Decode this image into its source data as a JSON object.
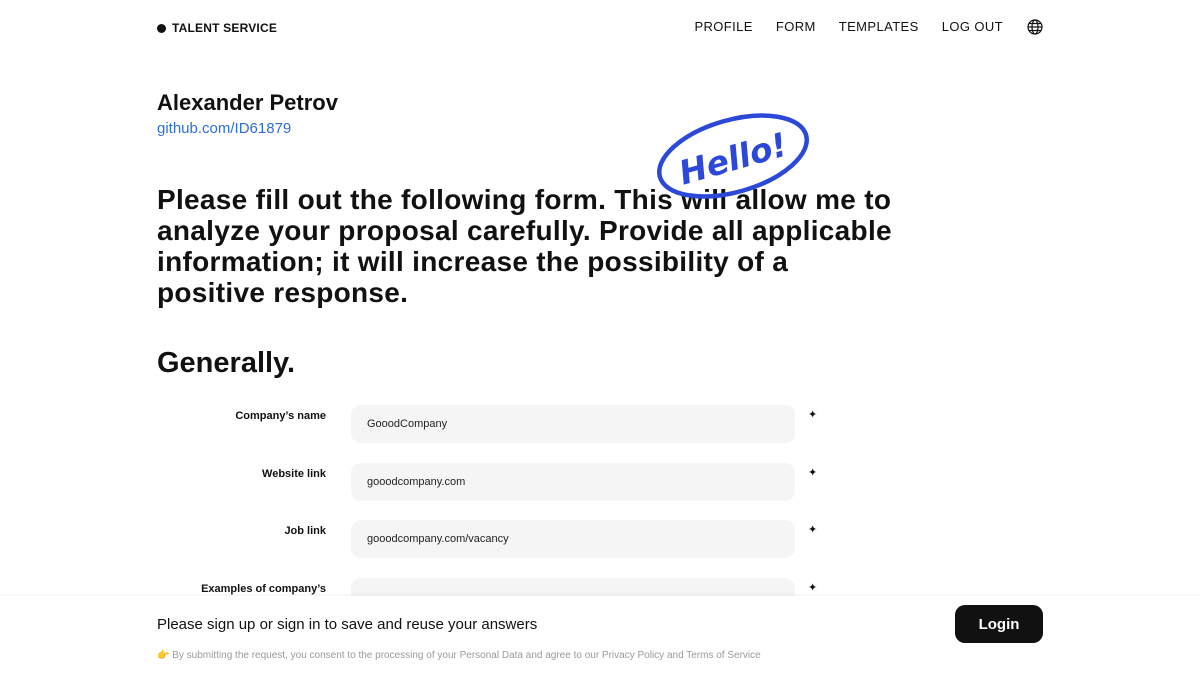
{
  "header": {
    "brand": "TALENT SERVICE",
    "nav": [
      "PROFILE",
      "FORM",
      "TEMPLATES",
      "LOG OUT"
    ],
    "language_icon": "globe-icon"
  },
  "profile": {
    "name": "Alexander Petrov",
    "link": "github.com/ID61879"
  },
  "stamp": {
    "text": "Hello!",
    "color": "#2b48d8"
  },
  "intro": "Please fill out the following form. This will allow me to analyze your proposal carefully. Provide all applicable information; it will increase the possibility of a positive response.",
  "section": {
    "title": "Generally.",
    "fields": [
      {
        "label": "Company’s name",
        "value": "GooodCompany",
        "required_mark": "✦"
      },
      {
        "label": "Website link",
        "value": "gooodcompany.com",
        "required_mark": "✦"
      },
      {
        "label": "Job link",
        "value": "gooodcompany.com/vacancy",
        "required_mark": "✦"
      },
      {
        "label": "Examples of company’s",
        "value": "",
        "required_mark": "✦"
      }
    ]
  },
  "footer": {
    "message": "Please sign up or sign in to save and reuse your answers",
    "consent_icon": "👉",
    "consent": "By submitting the request, you consent to the processing of your Personal Data and agree to our Privacy Policy and Terms of Service",
    "login_label": "Login"
  },
  "colors": {
    "link": "#2f6fd6",
    "button": "#111111",
    "input_bg": "#f5f5f5"
  }
}
